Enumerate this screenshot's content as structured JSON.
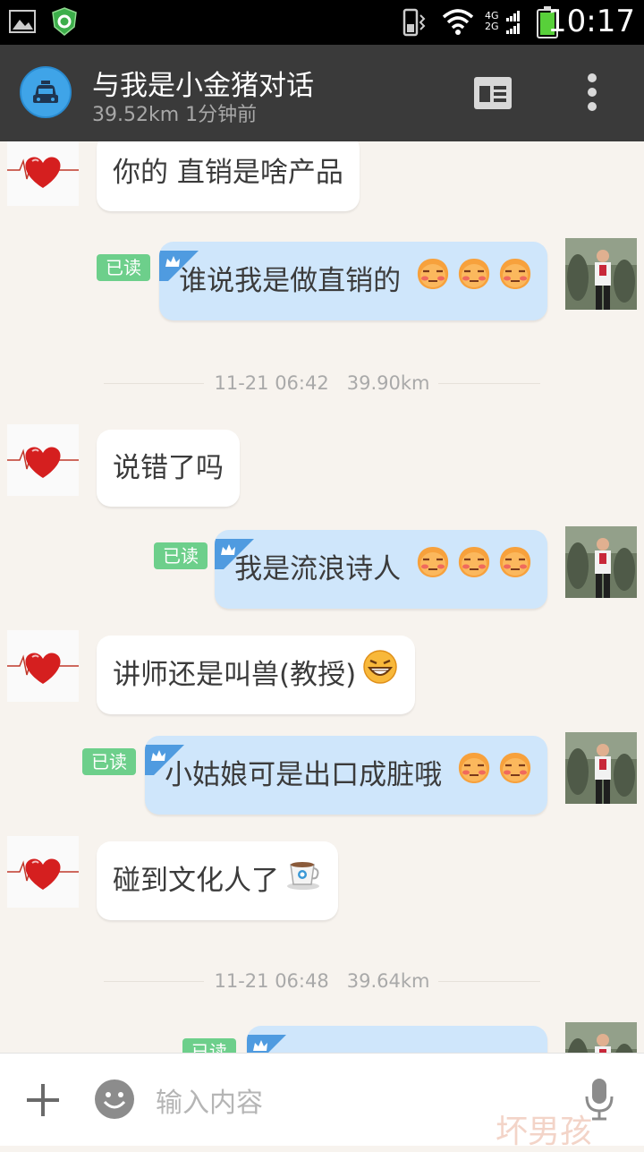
{
  "status_bar": {
    "time": "10:17",
    "network_top": "4G",
    "network_bottom": "2G"
  },
  "header": {
    "title": "与我是小金猪对话",
    "subtitle": "39.52km 1分钟前",
    "icons": [
      "taxi-avatar-icon",
      "profile-card-icon",
      "overflow-menu-icon"
    ]
  },
  "messages": [
    {
      "side": "left",
      "text": "你的  直销是啥产品"
    },
    {
      "side": "right",
      "text": "谁说我是做直销的",
      "read": "已读",
      "emojis": 3
    },
    {
      "type": "time",
      "time": "11-21 06:42",
      "distance": "39.90km"
    },
    {
      "side": "left",
      "text": "说错了吗"
    },
    {
      "side": "right",
      "text": "我是流浪诗人",
      "read": "已读",
      "emojis": 3
    },
    {
      "side": "left",
      "text": "讲师还是叫兽(教授)",
      "emojis": 1
    },
    {
      "side": "right",
      "text": "小姑娘可是出口成脏哦",
      "read": "已读",
      "emojis": 2
    },
    {
      "side": "left",
      "text": "碰到文化人了",
      "emojis": 1
    },
    {
      "type": "time",
      "time": "11-21 06:48",
      "distance": "39.64km"
    },
    {
      "side": "right",
      "read": "已读"
    }
  ],
  "input": {
    "placeholder": "输入内容",
    "watermark": "坏男孩"
  }
}
